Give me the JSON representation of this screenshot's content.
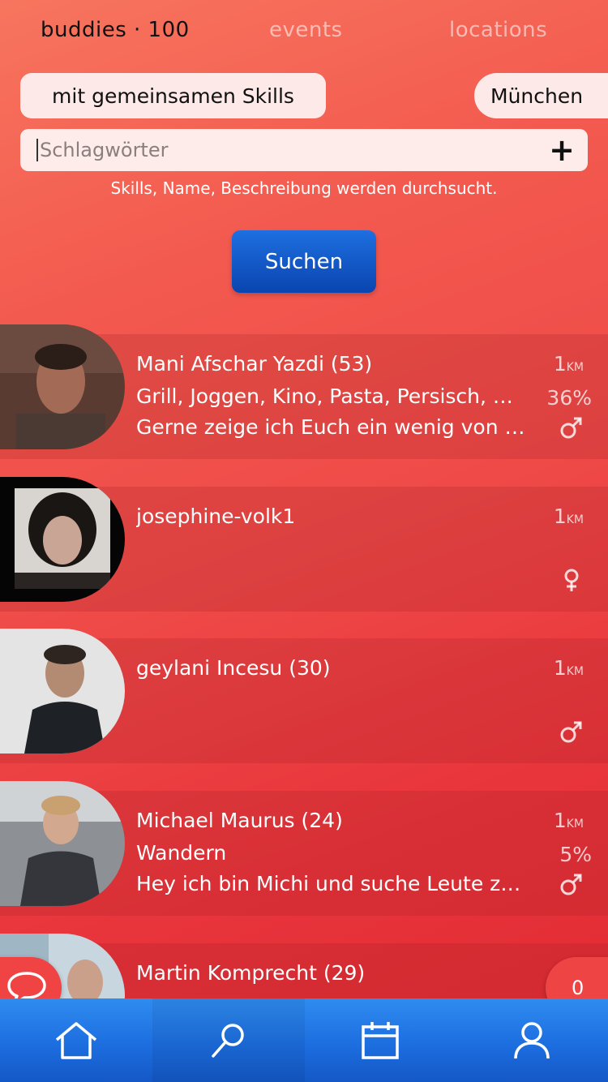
{
  "tabs": {
    "buddies": "buddies · 100",
    "events": "events",
    "locations": "locations"
  },
  "filters": {
    "skills_chip": "mit gemeinsamen Skills",
    "city_chip": "München"
  },
  "search": {
    "placeholder": "Schlagwörter",
    "add_icon": "plus-icon",
    "hint": "Skills, Name, Beschreibung werden durchsucht.",
    "button_label": "Suchen"
  },
  "results": [
    {
      "name": "Mani Afschar Yazdi (53)",
      "skills": "Grill, Joggen, Kino, Pasta, Persisch, Reisen",
      "description": "Gerne zeige ich Euch ein wenig von München",
      "distance": "1",
      "distance_unit": "KM",
      "match": "36%",
      "gender_icon": "male-icon"
    },
    {
      "name": "josephine-volk1",
      "skills": "",
      "description": "",
      "distance": "1",
      "distance_unit": "KM",
      "match": "",
      "gender_icon": "female-icon"
    },
    {
      "name": "geylani Incesu (30)",
      "skills": "",
      "description": "",
      "distance": "1",
      "distance_unit": "KM",
      "match": "",
      "gender_icon": "male-icon"
    },
    {
      "name": "Michael Maurus (24)",
      "skills": "Wandern",
      "description": "Hey ich bin Michi und suche Leute zum Wandern",
      "distance": "1",
      "distance_unit": "KM",
      "match": "5%",
      "gender_icon": "male-icon"
    },
    {
      "name": "Martin Komprecht (29)",
      "skills": "",
      "description": "",
      "distance": "",
      "distance_unit": "",
      "match": "",
      "gender_icon": ""
    }
  ],
  "chat": {
    "icon": "chat-bubble-icon",
    "badge_count": "0"
  },
  "bottom_nav": [
    {
      "icon": "home-icon"
    },
    {
      "icon": "search-icon"
    },
    {
      "icon": "calendar-icon"
    },
    {
      "icon": "user-icon"
    }
  ],
  "colors": {
    "background_start": "#f7755e",
    "background_end": "#e02a33",
    "button_blue": "#0a45b0",
    "nav_blue": "#1d6ee0"
  }
}
